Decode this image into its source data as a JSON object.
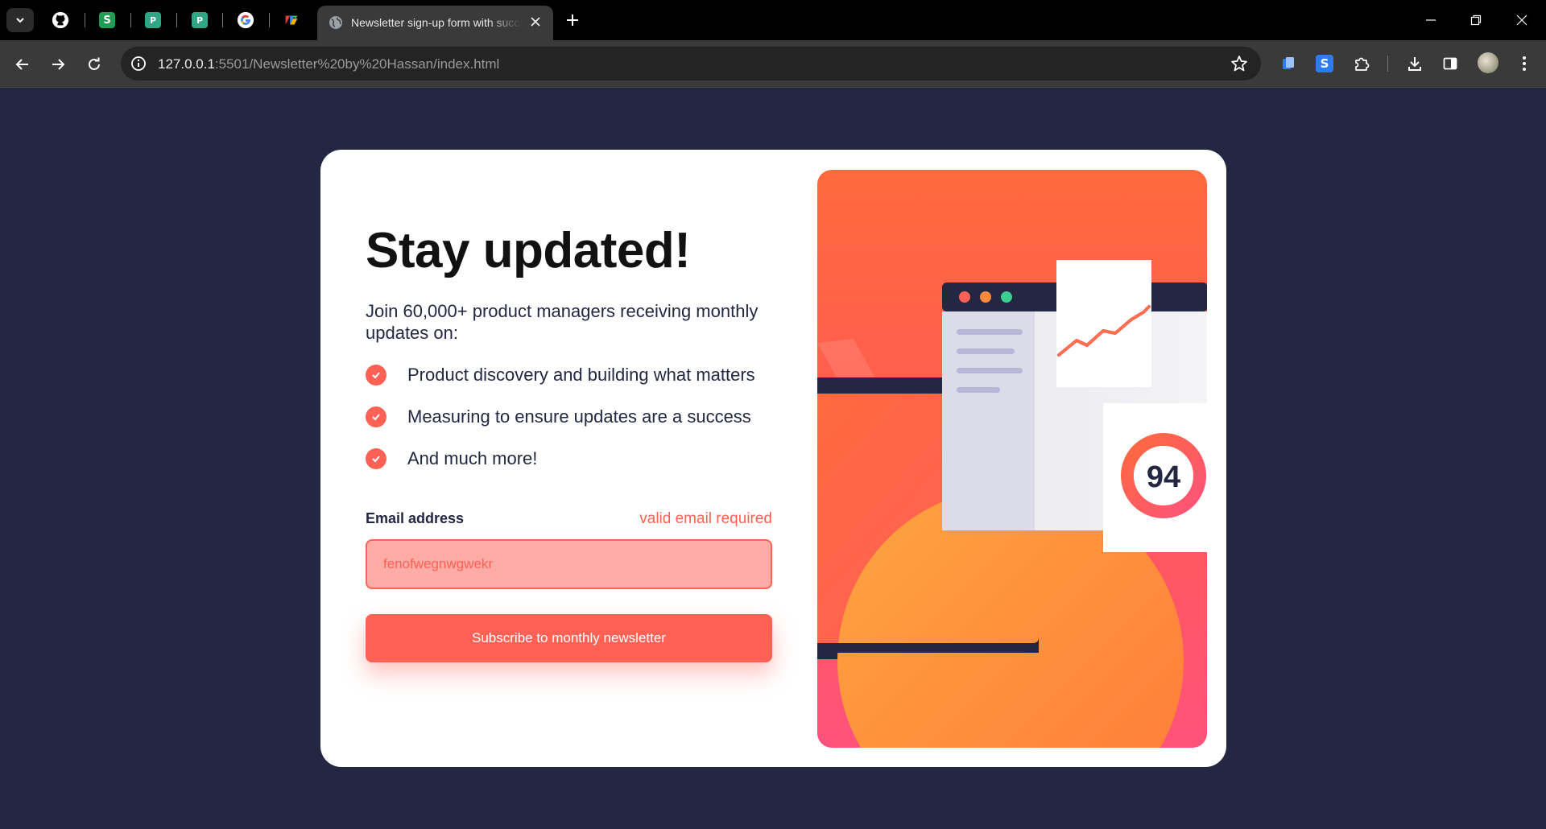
{
  "browser": {
    "active_tab_title": "Newsletter sign-up form with success message",
    "url_host": "127.0.0.1",
    "url_rest": ":5501/Newsletter%20by%20Hassan/index.html"
  },
  "card": {
    "heading": "Stay updated!",
    "intro": "Join 60,000+ product managers receiving monthly updates on:",
    "features": [
      "Product discovery and building what matters",
      "Measuring to ensure updates are a success",
      "And much more!"
    ],
    "email_label": "Email address",
    "email_error": "valid email required",
    "email_value": "fenofwegnwgwekr",
    "subscribe_label": "Subscribe to monthly newsletter"
  },
  "illustration": {
    "score": "94",
    "colors": {
      "navy": "#242742",
      "tomato": "#ff6155",
      "orange": "#ff8a3d",
      "pink": "#ff527b"
    }
  }
}
